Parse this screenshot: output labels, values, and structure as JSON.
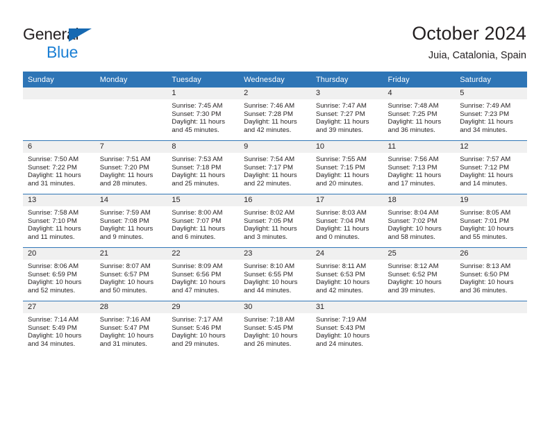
{
  "brand": {
    "name_part1": "General",
    "name_part2": "Blue",
    "logo_icon": "triangle-logo-icon"
  },
  "header": {
    "title": "October 2024",
    "subtitle": "Juia, Catalonia, Spain"
  },
  "colors": {
    "header_blue": "#2e75b6",
    "brand_dark": "#231f20",
    "brand_blue": "#1b7fd4",
    "logo_blue": "#1669b2",
    "day_band_gray": "#f0f0f0",
    "page_background": "#ffffff"
  },
  "calendar": {
    "weekday_headers": [
      "Sunday",
      "Monday",
      "Tuesday",
      "Wednesday",
      "Thursday",
      "Friday",
      "Saturday"
    ],
    "weeks": [
      [
        {
          "day": "",
          "detail": ""
        },
        {
          "day": "",
          "detail": ""
        },
        {
          "day": "1",
          "detail": "Sunrise: 7:45 AM\nSunset: 7:30 PM\nDaylight: 11 hours\nand 45 minutes."
        },
        {
          "day": "2",
          "detail": "Sunrise: 7:46 AM\nSunset: 7:28 PM\nDaylight: 11 hours\nand 42 minutes."
        },
        {
          "day": "3",
          "detail": "Sunrise: 7:47 AM\nSunset: 7:27 PM\nDaylight: 11 hours\nand 39 minutes."
        },
        {
          "day": "4",
          "detail": "Sunrise: 7:48 AM\nSunset: 7:25 PM\nDaylight: 11 hours\nand 36 minutes."
        },
        {
          "day": "5",
          "detail": "Sunrise: 7:49 AM\nSunset: 7:23 PM\nDaylight: 11 hours\nand 34 minutes."
        }
      ],
      [
        {
          "day": "6",
          "detail": "Sunrise: 7:50 AM\nSunset: 7:22 PM\nDaylight: 11 hours\nand 31 minutes."
        },
        {
          "day": "7",
          "detail": "Sunrise: 7:51 AM\nSunset: 7:20 PM\nDaylight: 11 hours\nand 28 minutes."
        },
        {
          "day": "8",
          "detail": "Sunrise: 7:53 AM\nSunset: 7:18 PM\nDaylight: 11 hours\nand 25 minutes."
        },
        {
          "day": "9",
          "detail": "Sunrise: 7:54 AM\nSunset: 7:17 PM\nDaylight: 11 hours\nand 22 minutes."
        },
        {
          "day": "10",
          "detail": "Sunrise: 7:55 AM\nSunset: 7:15 PM\nDaylight: 11 hours\nand 20 minutes."
        },
        {
          "day": "11",
          "detail": "Sunrise: 7:56 AM\nSunset: 7:13 PM\nDaylight: 11 hours\nand 17 minutes."
        },
        {
          "day": "12",
          "detail": "Sunrise: 7:57 AM\nSunset: 7:12 PM\nDaylight: 11 hours\nand 14 minutes."
        }
      ],
      [
        {
          "day": "13",
          "detail": "Sunrise: 7:58 AM\nSunset: 7:10 PM\nDaylight: 11 hours\nand 11 minutes."
        },
        {
          "day": "14",
          "detail": "Sunrise: 7:59 AM\nSunset: 7:08 PM\nDaylight: 11 hours\nand 9 minutes."
        },
        {
          "day": "15",
          "detail": "Sunrise: 8:00 AM\nSunset: 7:07 PM\nDaylight: 11 hours\nand 6 minutes."
        },
        {
          "day": "16",
          "detail": "Sunrise: 8:02 AM\nSunset: 7:05 PM\nDaylight: 11 hours\nand 3 minutes."
        },
        {
          "day": "17",
          "detail": "Sunrise: 8:03 AM\nSunset: 7:04 PM\nDaylight: 11 hours\nand 0 minutes."
        },
        {
          "day": "18",
          "detail": "Sunrise: 8:04 AM\nSunset: 7:02 PM\nDaylight: 10 hours\nand 58 minutes."
        },
        {
          "day": "19",
          "detail": "Sunrise: 8:05 AM\nSunset: 7:01 PM\nDaylight: 10 hours\nand 55 minutes."
        }
      ],
      [
        {
          "day": "20",
          "detail": "Sunrise: 8:06 AM\nSunset: 6:59 PM\nDaylight: 10 hours\nand 52 minutes."
        },
        {
          "day": "21",
          "detail": "Sunrise: 8:07 AM\nSunset: 6:57 PM\nDaylight: 10 hours\nand 50 minutes."
        },
        {
          "day": "22",
          "detail": "Sunrise: 8:09 AM\nSunset: 6:56 PM\nDaylight: 10 hours\nand 47 minutes."
        },
        {
          "day": "23",
          "detail": "Sunrise: 8:10 AM\nSunset: 6:55 PM\nDaylight: 10 hours\nand 44 minutes."
        },
        {
          "day": "24",
          "detail": "Sunrise: 8:11 AM\nSunset: 6:53 PM\nDaylight: 10 hours\nand 42 minutes."
        },
        {
          "day": "25",
          "detail": "Sunrise: 8:12 AM\nSunset: 6:52 PM\nDaylight: 10 hours\nand 39 minutes."
        },
        {
          "day": "26",
          "detail": "Sunrise: 8:13 AM\nSunset: 6:50 PM\nDaylight: 10 hours\nand 36 minutes."
        }
      ],
      [
        {
          "day": "27",
          "detail": "Sunrise: 7:14 AM\nSunset: 5:49 PM\nDaylight: 10 hours\nand 34 minutes."
        },
        {
          "day": "28",
          "detail": "Sunrise: 7:16 AM\nSunset: 5:47 PM\nDaylight: 10 hours\nand 31 minutes."
        },
        {
          "day": "29",
          "detail": "Sunrise: 7:17 AM\nSunset: 5:46 PM\nDaylight: 10 hours\nand 29 minutes."
        },
        {
          "day": "30",
          "detail": "Sunrise: 7:18 AM\nSunset: 5:45 PM\nDaylight: 10 hours\nand 26 minutes."
        },
        {
          "day": "31",
          "detail": "Sunrise: 7:19 AM\nSunset: 5:43 PM\nDaylight: 10 hours\nand 24 minutes."
        },
        {
          "day": "",
          "detail": ""
        },
        {
          "day": "",
          "detail": ""
        }
      ]
    ]
  }
}
